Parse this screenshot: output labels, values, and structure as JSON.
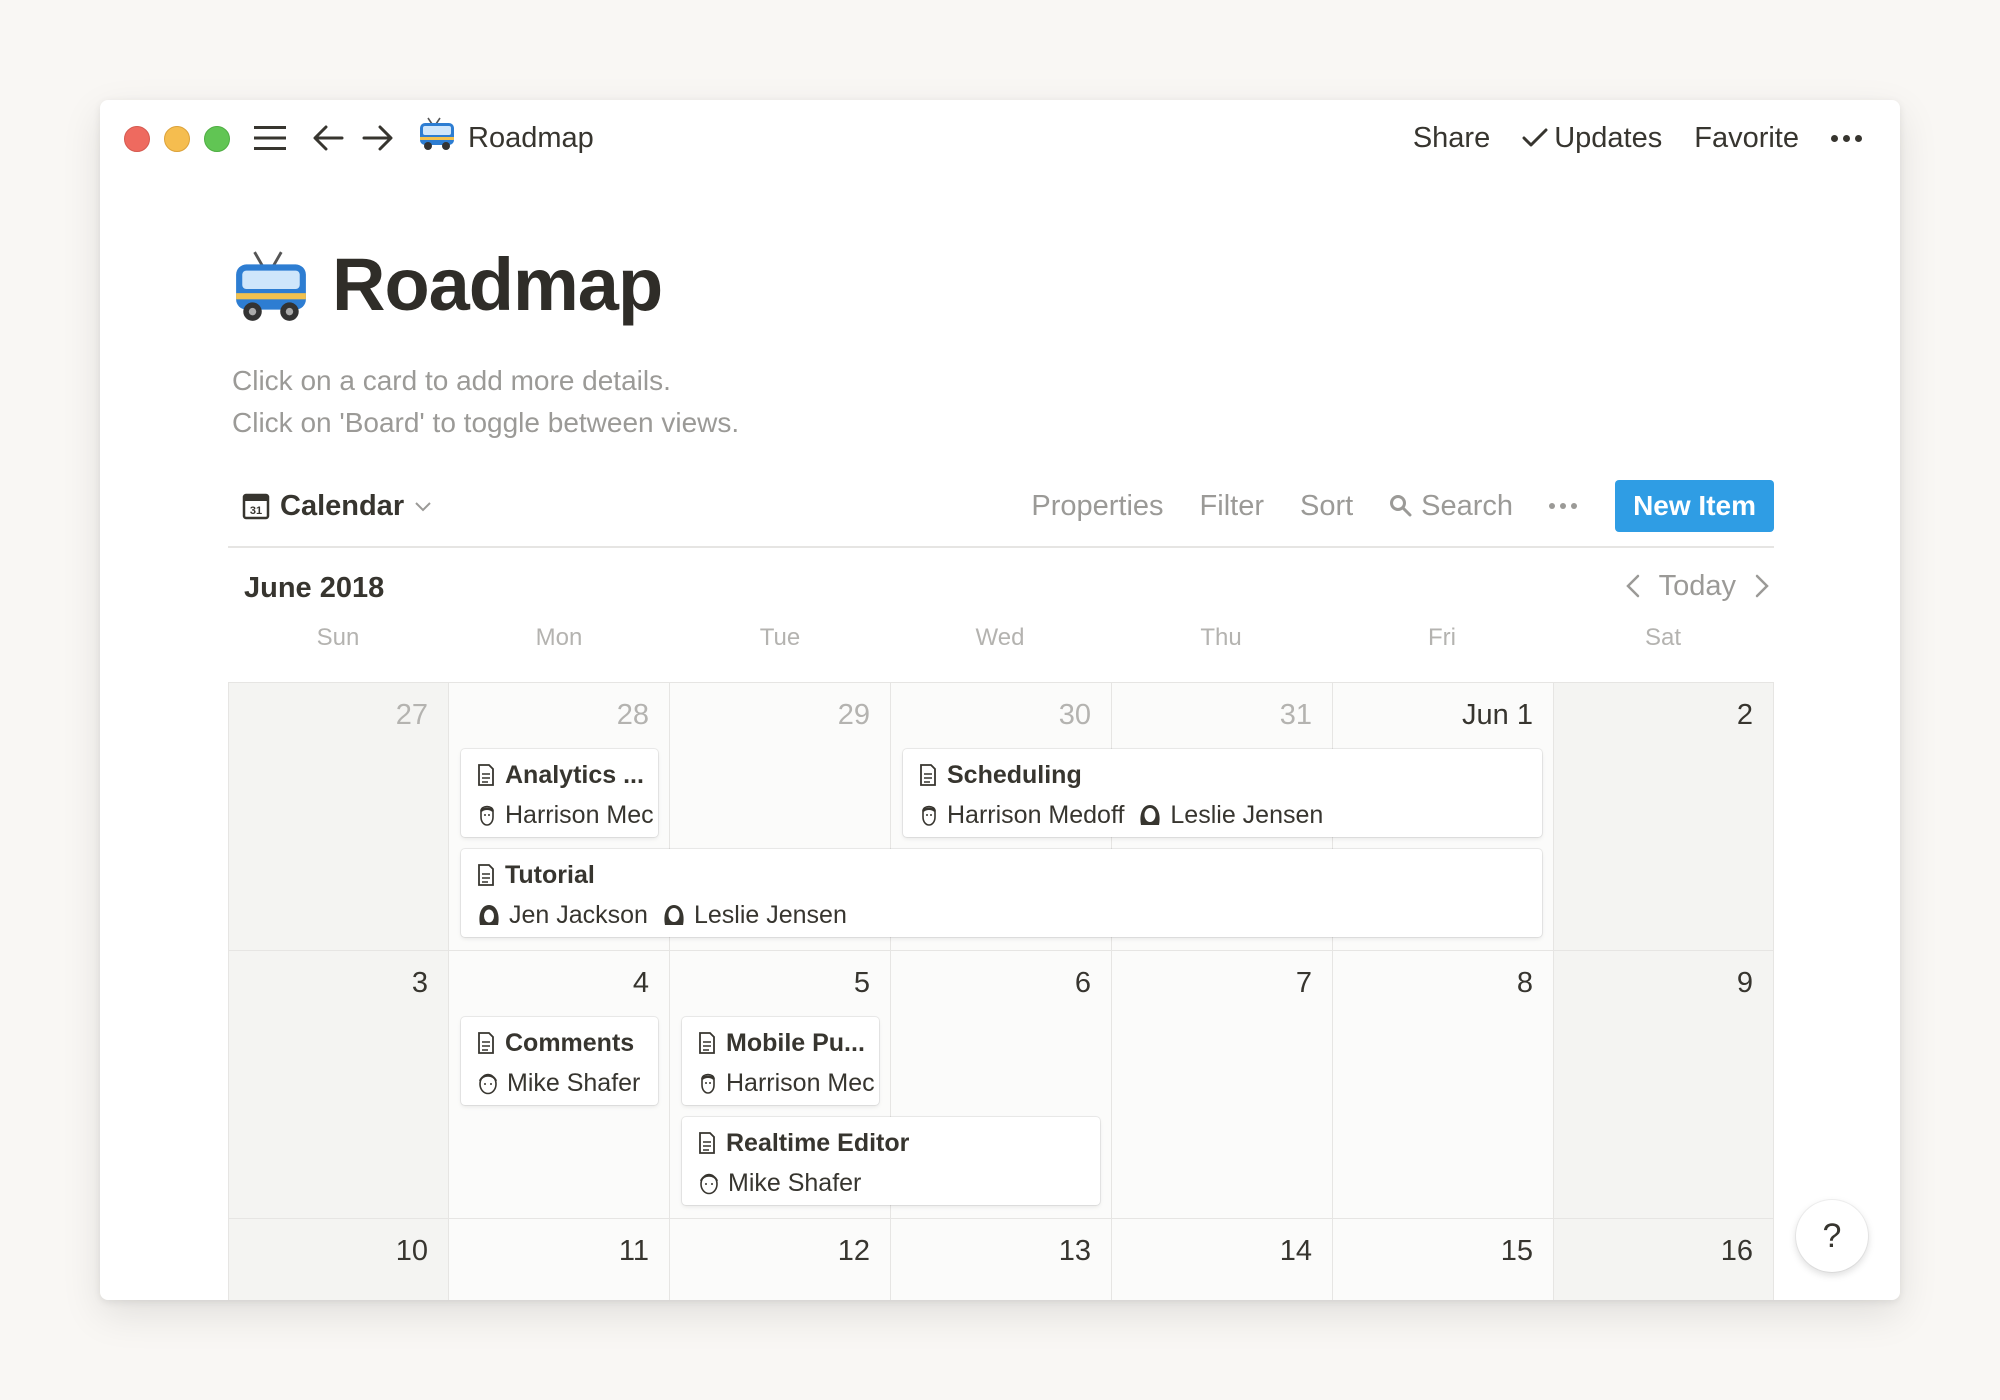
{
  "window": {
    "title": "Roadmap",
    "title_icon": "trolleybus-icon"
  },
  "topbar": {
    "share": "Share",
    "updates": "Updates",
    "favorite": "Favorite"
  },
  "page": {
    "title": "Roadmap",
    "description_lines": [
      "Click on a card to add more details.",
      "Click on 'Board' to toggle between views."
    ]
  },
  "view": {
    "name": "Calendar",
    "calendar_icon_text": "31",
    "actions": {
      "properties": "Properties",
      "filter": "Filter",
      "sort": "Sort",
      "search": "Search",
      "new_item": "New Item"
    }
  },
  "calendar": {
    "month_label": "June 2018",
    "today_label": "Today",
    "weekdays": [
      "Sun",
      "Mon",
      "Tue",
      "Wed",
      "Thu",
      "Fri",
      "Sat"
    ],
    "weeks": [
      [
        "27",
        "28",
        "29",
        "30",
        "31",
        "Jun 1",
        "2"
      ],
      [
        "3",
        "4",
        "5",
        "6",
        "7",
        "8",
        "9"
      ],
      [
        "10",
        "11",
        "12",
        "13",
        "14",
        "15",
        "16"
      ]
    ],
    "events": [
      {
        "title": "Analytics ...",
        "people": [
          "Harrison Mec"
        ]
      },
      {
        "title": "Scheduling",
        "people": [
          "Harrison Medoff",
          "Leslie Jensen"
        ]
      },
      {
        "title": "Tutorial",
        "people": [
          "Jen Jackson",
          "Leslie Jensen"
        ]
      },
      {
        "title": "Comments",
        "people": [
          "Mike Shafer"
        ]
      },
      {
        "title": "Mobile Pu...",
        "people": [
          "Harrison Mec"
        ]
      },
      {
        "title": "Realtime Editor",
        "people": [
          "Mike Shafer"
        ]
      }
    ]
  },
  "help_button": "?",
  "colors": {
    "accent": "#2f9de4",
    "background": "#f9f7f4",
    "text": "#37352f",
    "muted": "#9b9a97"
  }
}
